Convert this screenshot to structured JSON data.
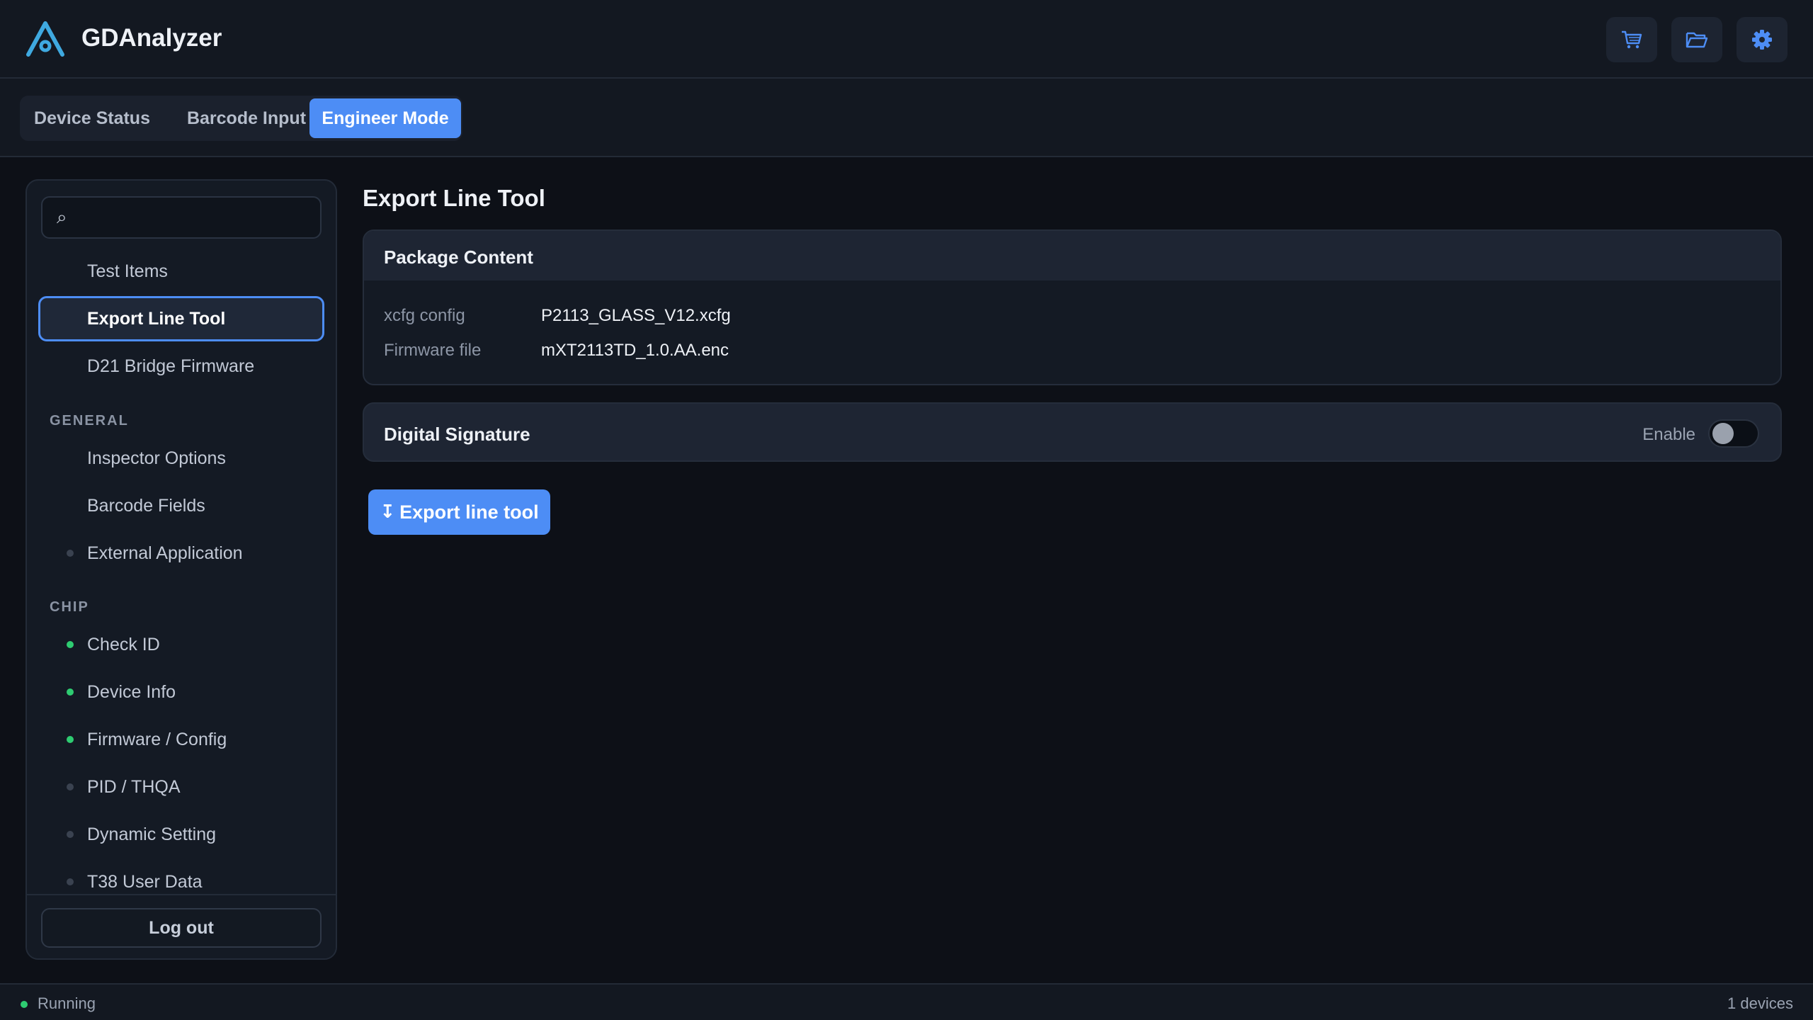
{
  "app": {
    "title": "GDAnalyzer",
    "accent_color": "#4d8df5",
    "logo_icon": "triangle-logo-icon",
    "header_buttons": [
      {
        "icon": "cart-icon"
      },
      {
        "icon": "folder-open-icon"
      },
      {
        "icon": "gear-icon"
      }
    ]
  },
  "tabs": [
    {
      "label": "Device Status",
      "active": false
    },
    {
      "label": "Barcode Input",
      "active": false
    },
    {
      "label": "Engineer Mode",
      "active": true
    }
  ],
  "sidebar": {
    "search": {
      "value": "",
      "placeholder": ""
    },
    "search_icon_glyph": "⌕",
    "top_items": [
      {
        "label": "Test Items"
      },
      {
        "label": "Export Line Tool",
        "active": true
      },
      {
        "label": "D21 Bridge Firmware"
      }
    ],
    "sections": [
      {
        "title": "GENERAL",
        "items": [
          {
            "label": "Inspector Options"
          },
          {
            "label": "Barcode Fields"
          },
          {
            "label": "External Application",
            "status": "inactive"
          }
        ]
      },
      {
        "title": "CHIP",
        "items": [
          {
            "label": "Check ID",
            "status": "ok"
          },
          {
            "label": "Device Info",
            "status": "ok"
          },
          {
            "label": "Firmware / Config",
            "status": "ok"
          },
          {
            "label": "PID / THQA",
            "status": "inactive"
          },
          {
            "label": "Dynamic Setting",
            "status": "inactive"
          },
          {
            "label": "T38 User Data",
            "status": "inactive"
          }
        ]
      }
    ],
    "logout_label": "Log out"
  },
  "main": {
    "title": "Export Line Tool",
    "package": {
      "title": "Package Content",
      "rows": [
        {
          "label": "xcfg config",
          "value": "P2113_GLASS_V12.xcfg"
        },
        {
          "label": "Firmware file",
          "value": "mXT2113TD_1.0.AA.enc"
        }
      ]
    },
    "signature": {
      "title": "Digital Signature",
      "enable_label": "Enable",
      "enabled": false
    },
    "export_button": {
      "arrow": "↧",
      "label": "Export line tool"
    }
  },
  "statusbar": {
    "status": "Running",
    "devices": "1 devices",
    "status_color": "#2ecc71"
  }
}
